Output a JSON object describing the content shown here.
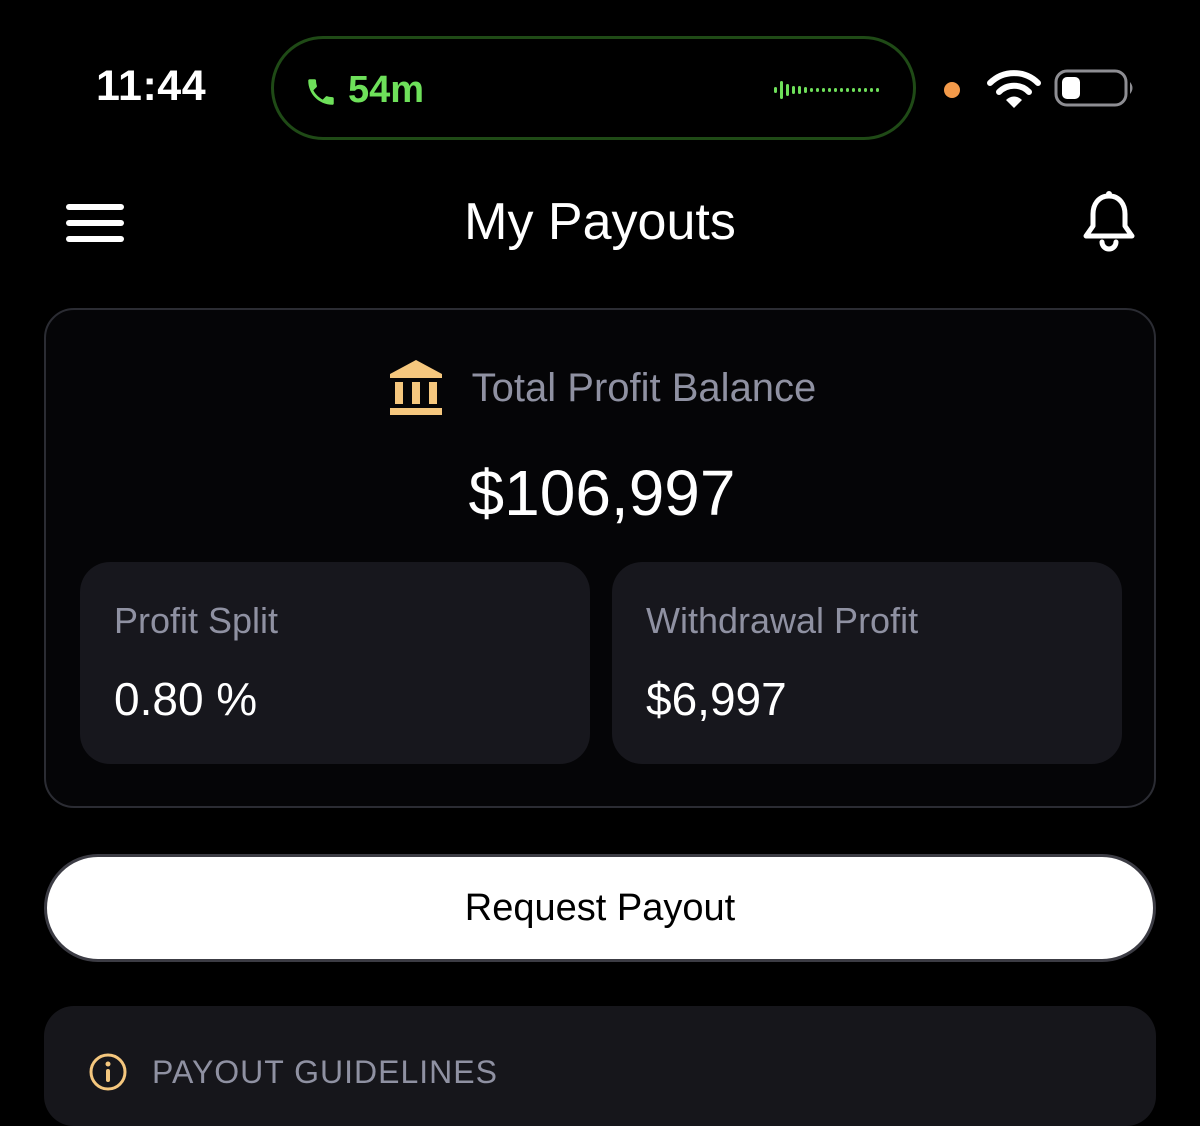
{
  "status_bar": {
    "time": "11:44",
    "call_duration": "54m",
    "icons": [
      "phone-icon",
      "audio-wave-icon",
      "mic-indicator",
      "wifi-icon",
      "battery-icon"
    ]
  },
  "header": {
    "title": "My Payouts",
    "icons": [
      "menu-icon",
      "bell-icon"
    ]
  },
  "balance_card": {
    "label": "Total Profit Balance",
    "amount": "$106,997",
    "icon": "bank-icon",
    "stats": [
      {
        "label": "Profit Split",
        "value": "0.80 %"
      },
      {
        "label": "Withdrawal Profit",
        "value": "$6,997"
      }
    ]
  },
  "actions": {
    "request_payout_label": "Request Payout"
  },
  "guidelines": {
    "title": "PAYOUT GUIDELINES",
    "icon": "info-icon"
  },
  "colors": {
    "background": "#000000",
    "accent_green": "#6ee05a",
    "bank_icon": "#f5c77e",
    "muted_text": "#8f91a2",
    "card_fill": "#17171d"
  }
}
